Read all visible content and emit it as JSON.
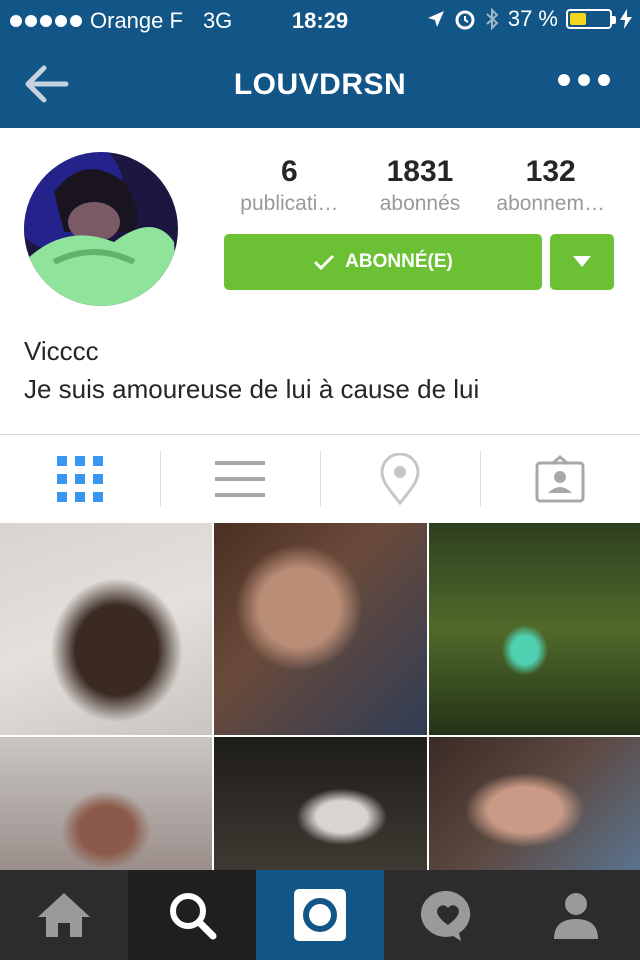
{
  "status_bar": {
    "carrier": "Orange F",
    "network": "3G",
    "time": "18:29",
    "battery": "37 %",
    "battery_level": 0.37
  },
  "nav": {
    "title": "LOUVDRSN"
  },
  "profile": {
    "stats": [
      {
        "value": "6",
        "label": "publicati…"
      },
      {
        "value": "1831",
        "label": "abonnés"
      },
      {
        "value": "132",
        "label": "abonnem…"
      }
    ],
    "follow_label": "ABONNÉ(E)",
    "name": "Vicccc",
    "bio": "Je suis amoureuse de lui à cause de lui"
  },
  "colors": {
    "header": "#125688",
    "follow_green": "#6bc133",
    "active_tab": "#3897f0"
  },
  "tabs": [
    "grid-view",
    "list-view",
    "location",
    "tagged"
  ],
  "bottom_tabs": [
    "home",
    "search",
    "camera",
    "activity",
    "profile"
  ]
}
